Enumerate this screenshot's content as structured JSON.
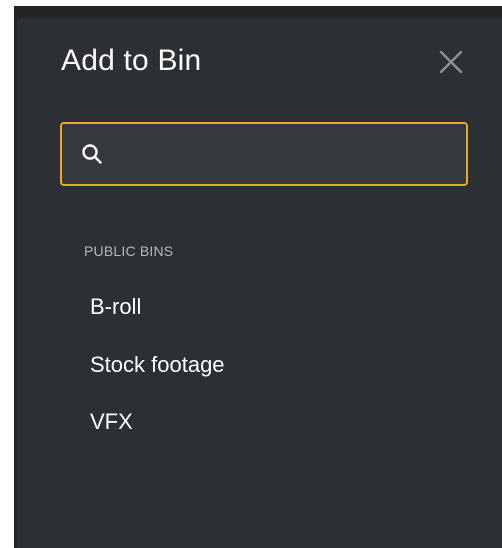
{
  "dialog": {
    "title": "Add to Bin",
    "close_icon": "close-icon"
  },
  "search": {
    "icon": "search-icon",
    "value": "",
    "placeholder": ""
  },
  "bins": {
    "section_label": "PUBLIC BINS",
    "items": [
      {
        "label": "B-roll"
      },
      {
        "label": "Stock footage"
      },
      {
        "label": "VFX"
      }
    ]
  },
  "colors": {
    "panel_background": "#2c2f33",
    "focus_accent": "#e8ad1a",
    "text_primary": "#ffffff",
    "text_secondary": "#b4b7bc"
  }
}
